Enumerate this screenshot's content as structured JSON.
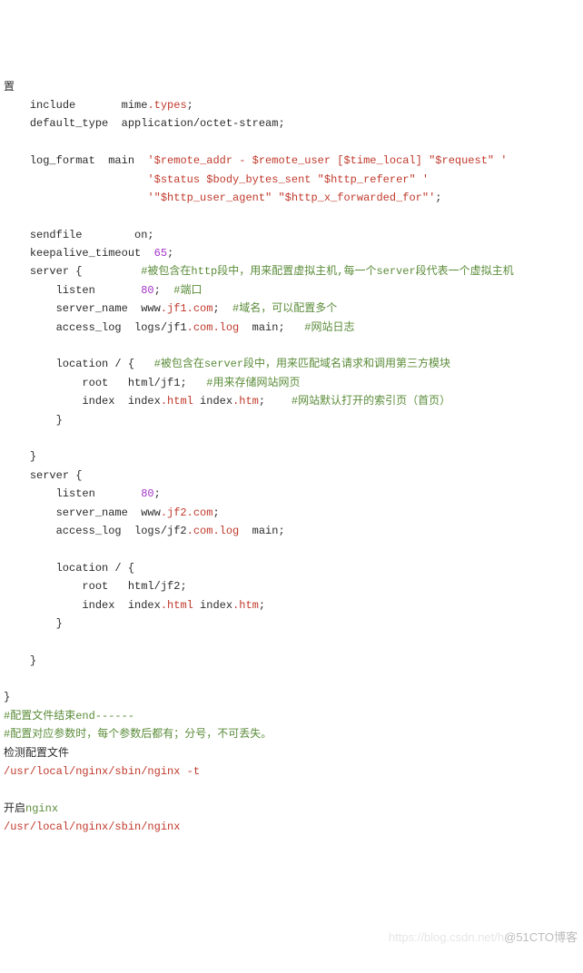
{
  "lines": [
    {
      "indent": 0,
      "parts": [
        {
          "t": "置"
        }
      ]
    },
    {
      "indent": 1,
      "parts": [
        {
          "t": "include       mime"
        },
        {
          "c": "str",
          "t": ".types"
        },
        {
          "t": ";"
        }
      ]
    },
    {
      "indent": 1,
      "parts": [
        {
          "t": "default_type  application/octet-stream;"
        }
      ]
    },
    {
      "indent": 0,
      "parts": [
        {
          "t": " "
        }
      ]
    },
    {
      "indent": 1,
      "parts": [
        {
          "t": "log_format  main  "
        },
        {
          "c": "str",
          "t": "'$remote_addr - $remote_user [$time_local] \"$request\" '"
        }
      ]
    },
    {
      "indent": 1,
      "parts": [
        {
          "t": "                  "
        },
        {
          "c": "str",
          "t": "'$status $body_bytes_sent \"$http_referer\" '"
        }
      ]
    },
    {
      "indent": 1,
      "parts": [
        {
          "t": "                  "
        },
        {
          "c": "str",
          "t": "'\"$http_user_agent\" \"$http_x_forwarded_for\"'"
        },
        {
          "t": ";"
        }
      ]
    },
    {
      "indent": 0,
      "parts": [
        {
          "t": " "
        }
      ]
    },
    {
      "indent": 1,
      "parts": [
        {
          "t": "sendfile        on;"
        }
      ]
    },
    {
      "indent": 1,
      "parts": [
        {
          "t": "keepalive_timeout  "
        },
        {
          "c": "num",
          "t": "65"
        },
        {
          "t": ";"
        }
      ]
    },
    {
      "indent": 1,
      "parts": [
        {
          "t": "server {         "
        },
        {
          "c": "cmt",
          "t": "#被包含在http段中，用来配置虚拟主机,每一个server段代表一个虚拟主机"
        }
      ]
    },
    {
      "indent": 2,
      "parts": [
        {
          "t": "listen       "
        },
        {
          "c": "num",
          "t": "80"
        },
        {
          "t": ";  "
        },
        {
          "c": "cmt",
          "t": "#端口"
        }
      ]
    },
    {
      "indent": 2,
      "parts": [
        {
          "t": "server_name  www"
        },
        {
          "c": "str",
          "t": ".jf1.com"
        },
        {
          "t": ";  "
        },
        {
          "c": "cmt",
          "t": "#域名，可以配置多个"
        }
      ]
    },
    {
      "indent": 2,
      "parts": [
        {
          "t": "access_log  logs/jf1"
        },
        {
          "c": "str",
          "t": ".com.log"
        },
        {
          "t": "  main;   "
        },
        {
          "c": "cmt",
          "t": "#网站日志"
        }
      ]
    },
    {
      "indent": 0,
      "parts": [
        {
          "t": " "
        }
      ]
    },
    {
      "indent": 2,
      "parts": [
        {
          "t": "location / {   "
        },
        {
          "c": "cmt",
          "t": "#被包含在server段中，用来匹配域名请求和调用第三方模块"
        }
      ]
    },
    {
      "indent": 3,
      "parts": [
        {
          "t": "root   html/jf1;   "
        },
        {
          "c": "cmt",
          "t": "#用来存储网站网页"
        }
      ]
    },
    {
      "indent": 3,
      "parts": [
        {
          "t": "index  index"
        },
        {
          "c": "str",
          "t": ".html"
        },
        {
          "t": " index"
        },
        {
          "c": "str",
          "t": ".htm"
        },
        {
          "t": ";    "
        },
        {
          "c": "cmt",
          "t": "#网站默认打开的索引页（首页）"
        }
      ]
    },
    {
      "indent": 2,
      "parts": [
        {
          "t": "}"
        }
      ]
    },
    {
      "indent": 0,
      "parts": [
        {
          "t": " "
        }
      ]
    },
    {
      "indent": 1,
      "parts": [
        {
          "t": "}"
        }
      ]
    },
    {
      "indent": 1,
      "parts": [
        {
          "t": "server {"
        }
      ]
    },
    {
      "indent": 2,
      "parts": [
        {
          "t": "listen       "
        },
        {
          "c": "num",
          "t": "80"
        },
        {
          "t": ";"
        }
      ]
    },
    {
      "indent": 2,
      "parts": [
        {
          "t": "server_name  www"
        },
        {
          "c": "str",
          "t": ".jf2.com"
        },
        {
          "t": ";"
        }
      ]
    },
    {
      "indent": 2,
      "parts": [
        {
          "t": "access_log  logs/jf2"
        },
        {
          "c": "str",
          "t": ".com.log"
        },
        {
          "t": "  main;"
        }
      ]
    },
    {
      "indent": 0,
      "parts": [
        {
          "t": " "
        }
      ]
    },
    {
      "indent": 2,
      "parts": [
        {
          "t": "location / {"
        }
      ]
    },
    {
      "indent": 3,
      "parts": [
        {
          "t": "root   html/jf2;"
        }
      ]
    },
    {
      "indent": 3,
      "parts": [
        {
          "t": "index  index"
        },
        {
          "c": "str",
          "t": ".html"
        },
        {
          "t": " index"
        },
        {
          "c": "str",
          "t": ".htm"
        },
        {
          "t": ";"
        }
      ]
    },
    {
      "indent": 2,
      "parts": [
        {
          "t": "}"
        }
      ]
    },
    {
      "indent": 0,
      "parts": [
        {
          "t": " "
        }
      ]
    },
    {
      "indent": 1,
      "parts": [
        {
          "t": "}"
        }
      ]
    },
    {
      "indent": 0,
      "parts": [
        {
          "t": " "
        }
      ]
    },
    {
      "indent": 0,
      "parts": [
        {
          "t": "}"
        }
      ]
    },
    {
      "indent": 0,
      "parts": [
        {
          "c": "cmt",
          "t": "#配置文件结束end------"
        }
      ]
    },
    {
      "indent": 0,
      "parts": [
        {
          "c": "cmt",
          "t": "#配置对应参数时，每个参数后都有；分号，不可丢失。"
        }
      ]
    },
    {
      "indent": 0,
      "parts": [
        {
          "t": "检测配置文件"
        }
      ]
    },
    {
      "indent": 0,
      "parts": [
        {
          "c": "str",
          "t": "/usr/local/nginx/sbin/nginx -t"
        }
      ]
    },
    {
      "indent": 0,
      "parts": [
        {
          "t": " "
        }
      ]
    },
    {
      "indent": 0,
      "parts": [
        {
          "t": "开启"
        },
        {
          "c": "cmt",
          "t": "nginx"
        }
      ]
    },
    {
      "indent": 0,
      "parts": [
        {
          "c": "str",
          "t": "/usr/local/nginx/sbin/nginx"
        }
      ]
    }
  ],
  "watermark_left": "https://blog.csdn.net/h",
  "watermark_right": "@51CTO博客"
}
